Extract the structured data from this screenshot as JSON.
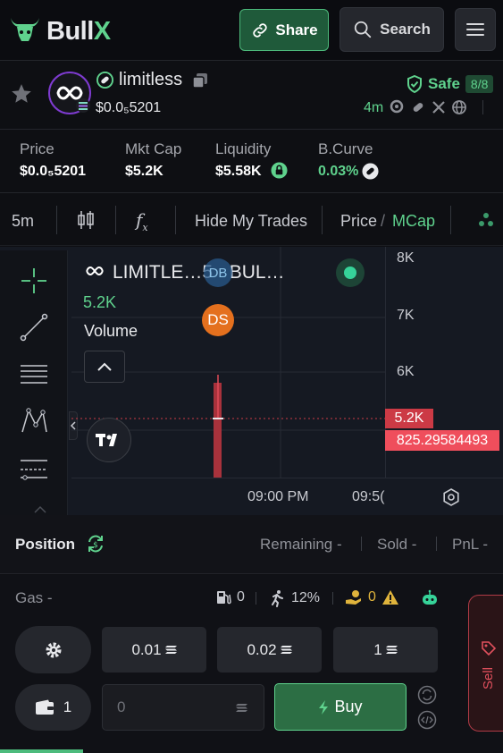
{
  "brand": {
    "name_main": "Bull",
    "name_accent": "X"
  },
  "header": {
    "share_label": "Share",
    "search_label": "Search"
  },
  "token": {
    "name": "limitless",
    "price": "$0.0₅5201",
    "safe_label": "Safe",
    "safe_score": "8/8",
    "age": "4m"
  },
  "stats": [
    {
      "label": "Price",
      "value": "$0.0₅5201"
    },
    {
      "label": "Mkt Cap",
      "value": "$5.2K"
    },
    {
      "label": "Liquidity",
      "value": "$5.58K"
    },
    {
      "label": "B.Curve",
      "value": "0.03%"
    }
  ],
  "toolbar": {
    "interval": "5m",
    "hide_trades": "Hide My Trades",
    "price_label": "Price",
    "slash": "/",
    "mcap_label": "MCap"
  },
  "chart": {
    "symbol_title": "LIMITLE…5 · BUL…",
    "badge_db": "DB",
    "badge_ds": "DS",
    "last_value": "5.2K",
    "volume_label": "Volume",
    "y_ticks": [
      "8K",
      "7K",
      "6K"
    ],
    "current_tag": "5.2K",
    "count_tag": "825.29584493",
    "x_ticks": [
      "09:00 PM",
      "09:5("
    ]
  },
  "chart_data": {
    "type": "candlestick",
    "y_range": [
      5000,
      8000
    ],
    "candles": [
      {
        "open": 5200,
        "high": 6000,
        "low": 5200,
        "close": 5200
      }
    ],
    "volume": [
      825.29584493
    ],
    "x_labels": [
      "09:00 PM",
      "09:5("
    ]
  },
  "position": {
    "title": "Position",
    "remaining": "Remaining -",
    "sold": "Sold -",
    "pnl": "PnL -"
  },
  "trade": {
    "gas_label": "Gas -",
    "gas_fuel": "0",
    "gas_slippage": "12%",
    "gas_priority": "0",
    "quick_amounts": [
      "0.01",
      "0.02",
      "1"
    ],
    "wallet_count": "1",
    "amount_placeholder": "0",
    "buy_label": "Buy",
    "sell_label": "Sell"
  },
  "colors": {
    "accent_green": "#5fd28d",
    "sell_red": "#e0505d",
    "avatar_ring": "#7e3bd0",
    "price_tag": "#cc3a45"
  }
}
